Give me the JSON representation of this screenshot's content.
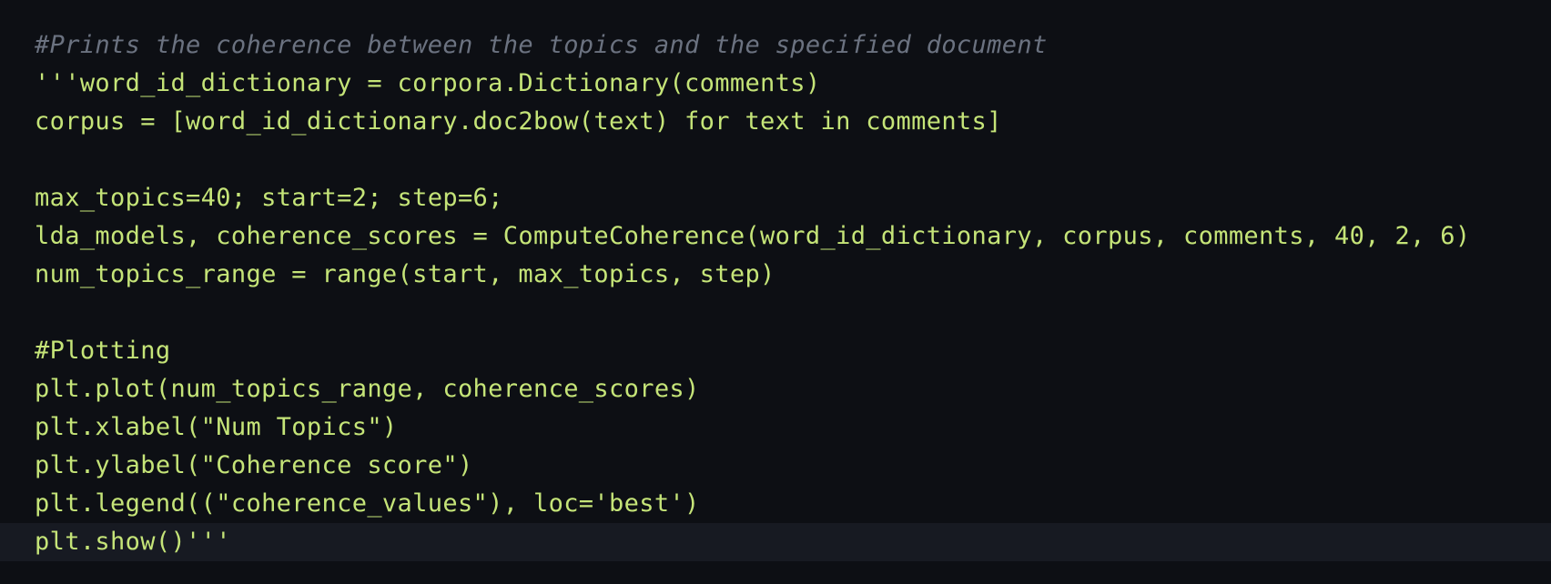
{
  "editor": {
    "colors": {
      "background": "#0d0f14",
      "text": "#c5e478",
      "comment": "#6b7280",
      "current_line": "#171a22"
    },
    "lines": [
      "#Prints the coherence between the topics and the specified document",
      "'''word_id_dictionary = corpora.Dictionary(comments)",
      "corpus = [word_id_dictionary.doc2bow(text) for text in comments]",
      "",
      "max_topics=40; start=2; step=6;",
      "lda_models, coherence_scores = ComputeCoherence(word_id_dictionary, corpus, comments, 40, 2, 6)",
      "num_topics_range = range(start, max_topics, step)",
      "",
      "#Plotting",
      "plt.plot(num_topics_range, coherence_scores)",
      "plt.xlabel(\"Num Topics\")",
      "plt.ylabel(\"Coherence score\")",
      "plt.legend((\"coherence_values\"), loc='best')",
      "plt.show()'''"
    ]
  }
}
